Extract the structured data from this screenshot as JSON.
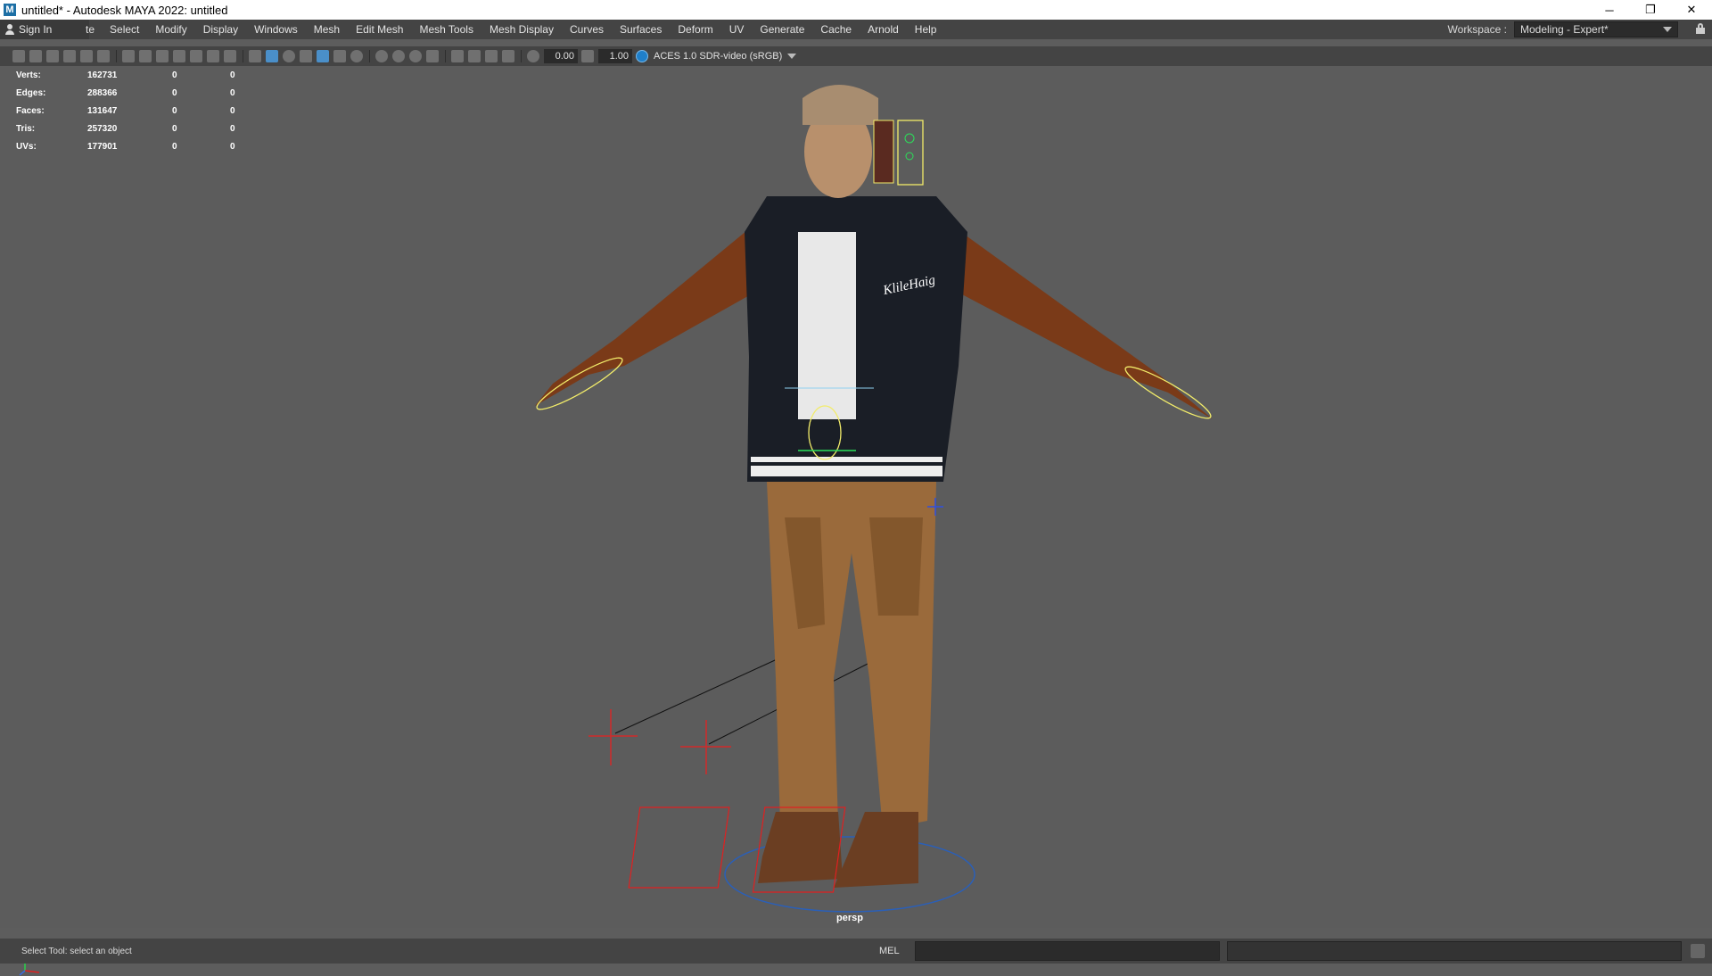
{
  "window": {
    "title": "untitled* - Autodesk MAYA 2022: untitled",
    "app_icon": "M",
    "controls": [
      "─",
      "❐",
      "✕"
    ]
  },
  "menubar": {
    "sign_in": "Sign In",
    "partial_item": "te",
    "items": [
      "Select",
      "Modify",
      "Display",
      "Windows",
      "Mesh",
      "Edit Mesh",
      "Mesh Tools",
      "Mesh Display",
      "Curves",
      "Surfaces",
      "Deform",
      "UV",
      "Generate",
      "Cache",
      "Arnold",
      "Help"
    ],
    "workspace_label": "Workspace :",
    "workspace_value": "Modeling - Expert*"
  },
  "toolbar": {
    "exposure": "0.00",
    "gamma": "1.00",
    "color_space": "ACES 1.0 SDR-video (sRGB)"
  },
  "hud": {
    "rows": [
      {
        "label": "Verts:",
        "v1": "162731",
        "v2": "0",
        "v3": "0"
      },
      {
        "label": "Edges:",
        "v1": "288366",
        "v2": "0",
        "v3": "0"
      },
      {
        "label": "Faces:",
        "v1": "131647",
        "v2": "0",
        "v3": "0"
      },
      {
        "label": "Tris:",
        "v1": "257320",
        "v2": "0",
        "v3": "0"
      },
      {
        "label": "UVs:",
        "v1": "177901",
        "v2": "0",
        "v3": "0"
      }
    ]
  },
  "viewport": {
    "camera": "persp",
    "jacket_text": "KlileHaig"
  },
  "statusbar": {
    "help_line": "Select Tool: select an object",
    "command_language": "MEL"
  }
}
